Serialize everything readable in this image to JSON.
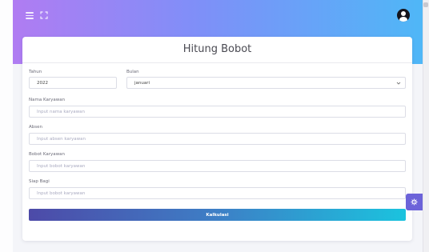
{
  "header": {
    "menu_icon": "hamburger-menu-icon",
    "expand_icon": "fullscreen-icon",
    "avatar_icon": "user-avatar-icon"
  },
  "form": {
    "title": "Hitung Bobot",
    "fields": {
      "tahun": {
        "label": "Tahun",
        "value": "2022"
      },
      "bulan": {
        "label": "Bulan",
        "value": "januari"
      },
      "nama": {
        "label": "Nama Karyawan",
        "placeholder": "Input nama karyawan"
      },
      "absen": {
        "label": "Absen",
        "placeholder": "Input absen karyawan"
      },
      "bobot": {
        "label": "Bobot Karyawan",
        "placeholder": "Input bobot karyawan"
      },
      "siap_bagi": {
        "label": "Siap Bagi",
        "placeholder": "Input bobot karyawan"
      }
    },
    "submit_label": "Kalkulasi"
  },
  "colors": {
    "header_gradient_start": "#b07cf2",
    "header_gradient_end": "#4fb7f7",
    "button_gradient_start": "#4d4aa8",
    "button_gradient_end": "#1bc3de",
    "settings_fab": "#6c63d9"
  },
  "settings_icon": "gear-icon"
}
